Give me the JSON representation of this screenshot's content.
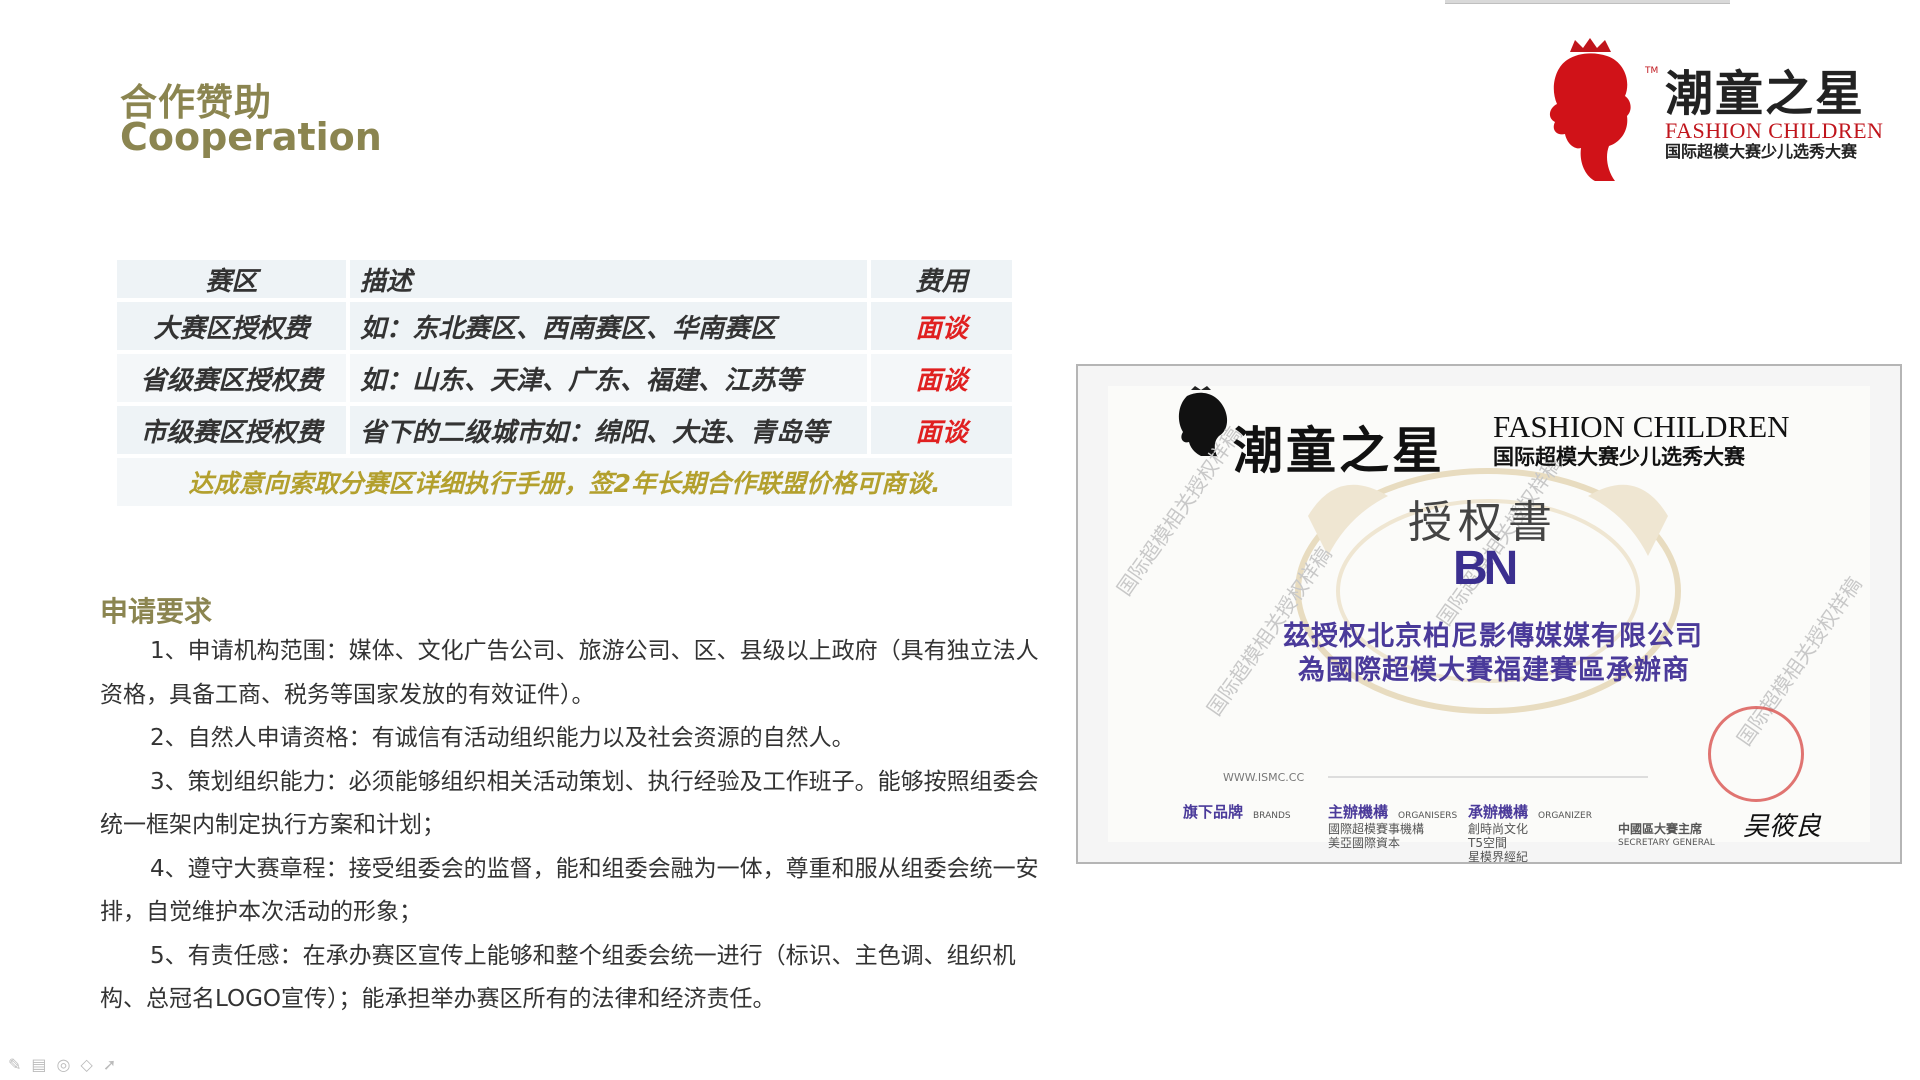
{
  "header": {
    "title_cn": "合作赞助",
    "title_en": "Cooperation"
  },
  "logo": {
    "name": "潮童之星",
    "tm": "TM",
    "en": "FASHION CHILDREN",
    "sub": "国际超模大赛少儿选秀大赛"
  },
  "table": {
    "headers": [
      "赛区",
      "描述",
      "费用"
    ],
    "rows": [
      {
        "region": "大赛区授权费",
        "desc": "如：东北赛区、西南赛区、华南赛区",
        "fee": "面谈"
      },
      {
        "region": "省级赛区授权费",
        "desc": "如：山东、天津、广东、福建、江苏等",
        "fee": "面谈"
      },
      {
        "region": "市级赛区授权费",
        "desc": "省下的二级城市如：绵阳、大连、青岛等",
        "fee": "面谈"
      }
    ],
    "note": "达成意向索取分赛区详细执行手册，签2年长期合作联盟价格可商谈."
  },
  "requirements": {
    "title": "申请要求",
    "items": [
      "1、申请机构范围：媒体、文化广告公司、旅游公司、区、县级以上政府（具有独立法人资格，具备工商、税务等国家发放的有效证件）。",
      "2、自然人申请资格：有诚信有活动组织能力以及社会资源的自然人。",
      "3、策划组织能力：必须能够组织相关活动策划、执行经验及工作班子。能够按照组委会统一框架内制定执行方案和计划；",
      "4、遵守大赛章程：接受组委会的监督，能和组委会融为一体，尊重和服从组委会统一安排，自觉维护本次活动的形象；",
      "5、有责任感：在承办赛区宣传上能够和整个组委会统一进行（标识、主色调、组织机构、总冠名LOGO宣传）；能承担举办赛区所有的法律和经济责任。"
    ]
  },
  "certificate": {
    "brand_cn": "潮童之星",
    "brand_en": "FASHION CHILDREN",
    "brand_sub": "国际超模大赛少儿选秀大赛",
    "title": "授权書",
    "bn": "BN",
    "line1": "茲授权北京柏尼影傳媒媒有限公司",
    "line2": "為國際超模大賽福建賽區承辦商",
    "url": "WWW.ISMC.CC",
    "watermark": "国际超模相关授权样稿",
    "footer": {
      "brands": "旗下品牌",
      "brands_en": "BRANDS",
      "organisers": "主辦機構",
      "organisers_en": "ORGANISERS",
      "organisers_1": "國際超模賽事機構",
      "organisers_2": "美亞國際資本",
      "organizer": "承辦機構",
      "organizer_en": "ORGANIZER",
      "organizer_1": "創時尚文化",
      "organizer_2": "T5空間",
      "organizer_3": "星模界經紀",
      "chair": "中國區大賽主席",
      "chair_en": "SECRETARY GENERAL",
      "signature": "吴筱良"
    }
  },
  "colors": {
    "title": "#8b8550",
    "fee_red": "#e02020",
    "note_gold": "#b3a02e",
    "logo_red": "#c0151c",
    "cert_purple": "#4a3a9a"
  },
  "toolbar": {
    "icons": [
      "pen-icon",
      "slides-icon",
      "zoom-icon",
      "eraser-icon",
      "pointer-icon"
    ]
  }
}
